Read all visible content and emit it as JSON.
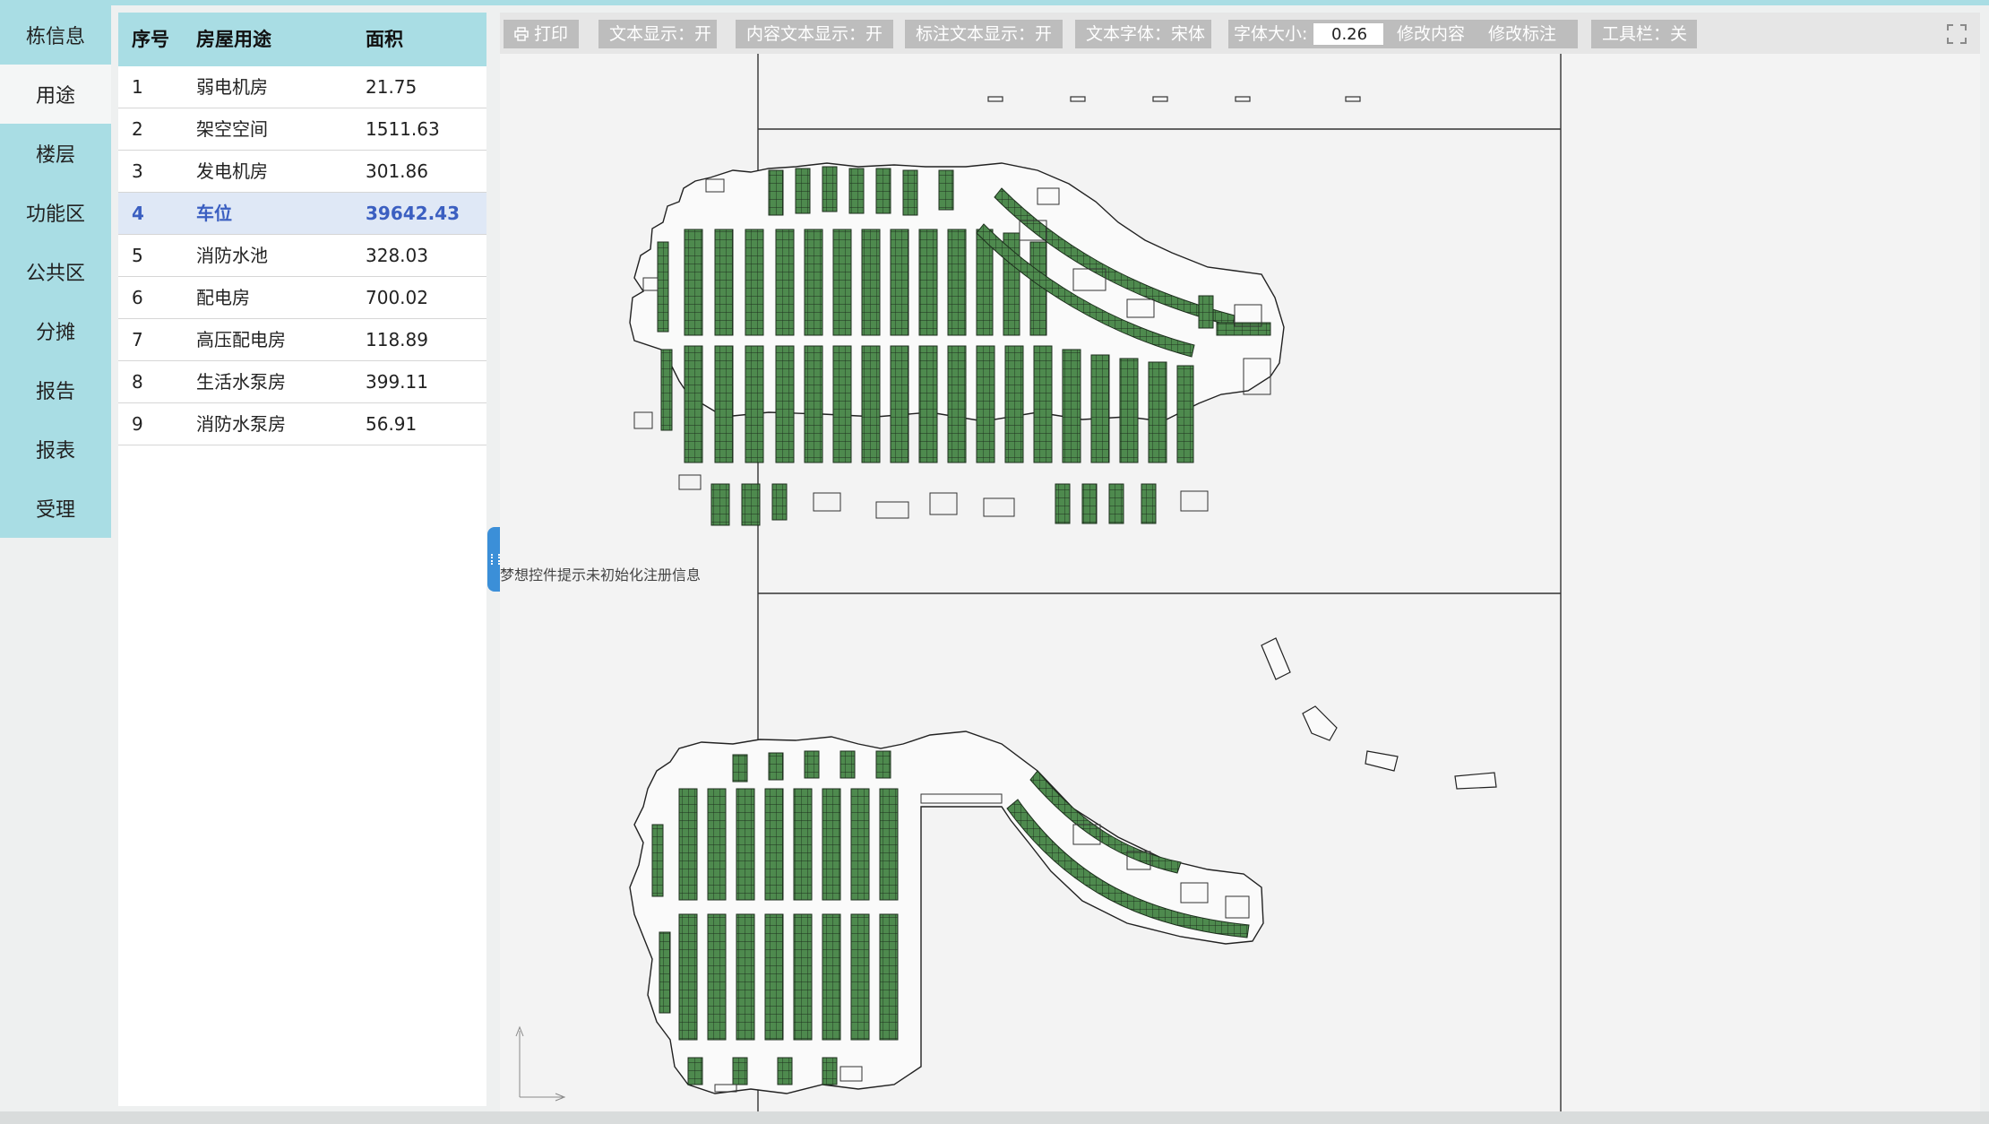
{
  "nav": {
    "items": [
      {
        "label": "栋信息"
      },
      {
        "label": "用途"
      },
      {
        "label": "楼层"
      },
      {
        "label": "功能区"
      },
      {
        "label": "公共区"
      },
      {
        "label": "分摊"
      },
      {
        "label": "报告"
      },
      {
        "label": "报表"
      },
      {
        "label": "受理"
      }
    ],
    "active": "用途"
  },
  "table": {
    "headers": {
      "index": "序号",
      "usage": "房屋用途",
      "area": "面积"
    },
    "rows": [
      {
        "index": "1",
        "usage": "弱电机房",
        "area": "21.75"
      },
      {
        "index": "2",
        "usage": "架空空间",
        "area": "1511.63"
      },
      {
        "index": "3",
        "usage": "发电机房",
        "area": "301.86"
      },
      {
        "index": "4",
        "usage": "车位",
        "area": "39642.43"
      },
      {
        "index": "5",
        "usage": "消防水池",
        "area": "328.03"
      },
      {
        "index": "6",
        "usage": "配电房",
        "area": "700.02"
      },
      {
        "index": "7",
        "usage": "高压配电房",
        "area": "118.89"
      },
      {
        "index": "8",
        "usage": "生活水泵房",
        "area": "399.11"
      },
      {
        "index": "9",
        "usage": "消防水泵房",
        "area": "56.91"
      }
    ],
    "selected_index": "4"
  },
  "toolbar": {
    "print": "打印",
    "text_display": "文本显示：开",
    "content_text_display": "内容文本显示：开",
    "annotation_text_display": "标注文本显示：开",
    "text_font": "文本字体：宋体",
    "font_size_label": "字体大小:",
    "font_size_value": "0.26",
    "edit_content": "修改内容",
    "edit_annotation": "修改标注",
    "toolbar_toggle": "工具栏：关"
  },
  "viewer": {
    "warning": "梦想控件提示未初始化注册信息"
  },
  "colors": {
    "accent": "#a9dde4",
    "selected_row_bg": "#dfe8f6",
    "selected_row_text": "#3b5fc1",
    "parking": "#4e8a4e",
    "toolbar_button": "#bdbdbd",
    "handle": "#3b8fd8"
  }
}
